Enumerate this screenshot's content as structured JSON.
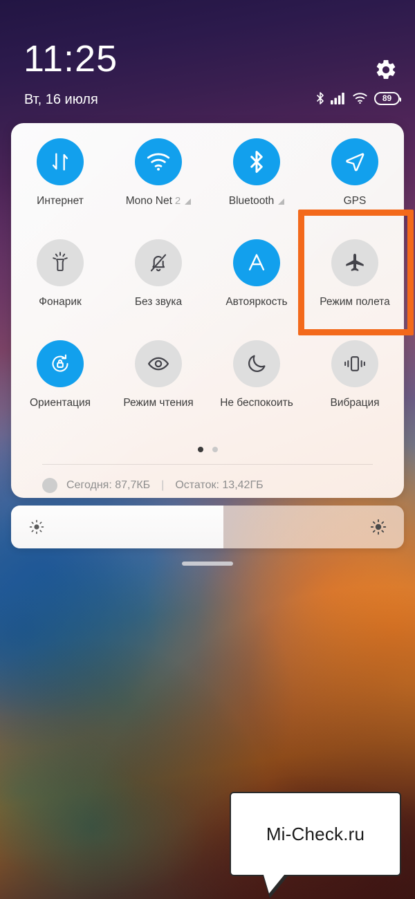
{
  "status_bar": {
    "clock": "11:25",
    "date": "Вт, 16 июля",
    "settings_icon": "gear-icon",
    "icons": [
      "bluetooth-icon",
      "cellular-signal-icon",
      "wifi-icon"
    ],
    "battery_level": "89"
  },
  "quick_settings": {
    "tiles": [
      {
        "label": "Интернет",
        "sub": "",
        "icon": "data-transfer-icon",
        "active": true,
        "triangle": false
      },
      {
        "label": "Mono Net",
        "sub": "2",
        "icon": "wifi-icon",
        "active": true,
        "triangle": true
      },
      {
        "label": "Bluetooth",
        "sub": "",
        "icon": "bluetooth-icon",
        "active": true,
        "triangle": true
      },
      {
        "label": "GPS",
        "sub": "",
        "icon": "navigation-arrow-icon",
        "active": true,
        "triangle": false
      },
      {
        "label": "Фонарик",
        "sub": "",
        "icon": "flashlight-icon",
        "active": false,
        "triangle": false
      },
      {
        "label": "Без звука",
        "sub": "",
        "icon": "bell-off-icon",
        "active": false,
        "triangle": false
      },
      {
        "label": "Автояркость",
        "sub": "",
        "icon": "auto-brightness-icon",
        "active": true,
        "triangle": false
      },
      {
        "label": "Режим полета",
        "sub": "",
        "icon": "airplane-icon",
        "active": false,
        "triangle": false
      },
      {
        "label": "Ориентация",
        "sub": "",
        "icon": "rotation-lock-icon",
        "active": true,
        "triangle": false
      },
      {
        "label": "Режим чтения",
        "sub": "",
        "icon": "eye-icon",
        "active": false,
        "triangle": false
      },
      {
        "label": "Не беспокоить",
        "sub": "",
        "icon": "moon-icon",
        "active": false,
        "triangle": false
      },
      {
        "label": "Вибрация",
        "sub": "",
        "icon": "vibration-icon",
        "active": false,
        "triangle": false
      }
    ],
    "pager": {
      "pages": 2,
      "active_page": 1
    },
    "data_usage": {
      "today_label": "Сегодня: 87,7КБ",
      "separator": "|",
      "remaining_label": "Остаток: 13,42ГБ"
    }
  },
  "brightness": {
    "low_icon": "brightness-low-icon",
    "high_icon": "brightness-high-icon",
    "fill_percent": 54
  },
  "annotation": {
    "highlight_target": "Режим полета",
    "color": "#f3691b"
  },
  "watermark": {
    "text": "Mi-Check.ru"
  },
  "colors": {
    "tile_active": "#12a0ed",
    "tile_inactive": "#dedede",
    "panel_bg": "#f8f5f3",
    "highlight": "#f3691b"
  }
}
